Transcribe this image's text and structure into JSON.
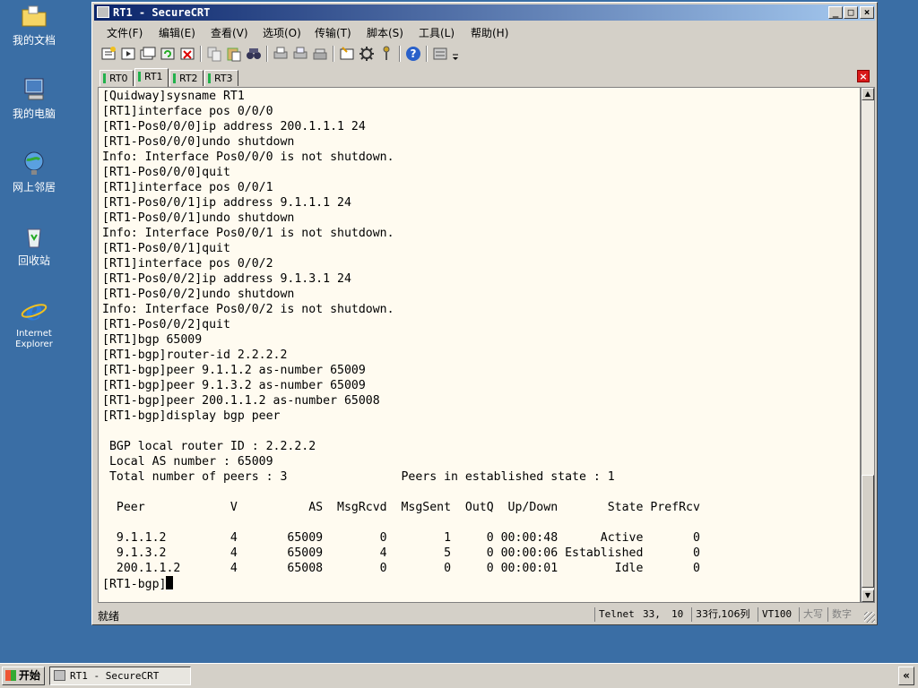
{
  "desktop": {
    "icons": [
      {
        "label": "我的文档"
      },
      {
        "label": "我的电脑"
      },
      {
        "label": "网上邻居"
      },
      {
        "label": "回收站"
      },
      {
        "label": "Internet Explorer"
      }
    ]
  },
  "window": {
    "title": "RT1 - SecureCRT",
    "menu": [
      "文件(F)",
      "编辑(E)",
      "查看(V)",
      "选项(O)",
      "传输(T)",
      "脚本(S)",
      "工具(L)",
      "帮助(H)"
    ],
    "tabs": [
      {
        "label": "RT0",
        "active": false
      },
      {
        "label": "RT1",
        "active": true
      },
      {
        "label": "RT2",
        "active": false
      },
      {
        "label": "RT3",
        "active": false
      }
    ]
  },
  "terminal": {
    "lines": [
      "[Quidway]sysname RT1",
      "[RT1]interface pos 0/0/0",
      "[RT1-Pos0/0/0]ip address 200.1.1.1 24",
      "[RT1-Pos0/0/0]undo shutdown",
      "Info: Interface Pos0/0/0 is not shutdown.",
      "[RT1-Pos0/0/0]quit",
      "[RT1]interface pos 0/0/1",
      "[RT1-Pos0/0/1]ip address 9.1.1.1 24",
      "[RT1-Pos0/0/1]undo shutdown",
      "Info: Interface Pos0/0/1 is not shutdown.",
      "[RT1-Pos0/0/1]quit",
      "[RT1]interface pos 0/0/2",
      "[RT1-Pos0/0/2]ip address 9.1.3.1 24",
      "[RT1-Pos0/0/2]undo shutdown",
      "Info: Interface Pos0/0/2 is not shutdown.",
      "[RT1-Pos0/0/2]quit",
      "[RT1]bgp 65009",
      "[RT1-bgp]router-id 2.2.2.2",
      "[RT1-bgp]peer 9.1.1.2 as-number 65009",
      "[RT1-bgp]peer 9.1.3.2 as-number 65009",
      "[RT1-bgp]peer 200.1.1.2 as-number 65008",
      "[RT1-bgp]display bgp peer",
      "",
      " BGP local router ID : 2.2.2.2",
      " Local AS number : 65009",
      " Total number of peers : 3                Peers in established state : 1",
      "",
      "  Peer            V          AS  MsgRcvd  MsgSent  OutQ  Up/Down       State PrefRcv",
      "",
      "  9.1.1.2         4       65009        0        1     0 00:00:48      Active       0",
      "  9.1.3.2         4       65009        4        5     0 00:00:06 Established       0",
      "  200.1.1.2       4       65008        0        0     0 00:00:01        Idle       0"
    ],
    "prompt": "[RT1-bgp]"
  },
  "statusbar": {
    "ready": "就绪",
    "protocol": "Telnet",
    "row": "33,",
    "col": "10",
    "size": "33行,106列",
    "emulation": "VT100",
    "caps": "大写",
    "num": "数字"
  },
  "taskbar": {
    "start": "开始",
    "task": "RT1 - SecureCRT",
    "tray": "«"
  }
}
